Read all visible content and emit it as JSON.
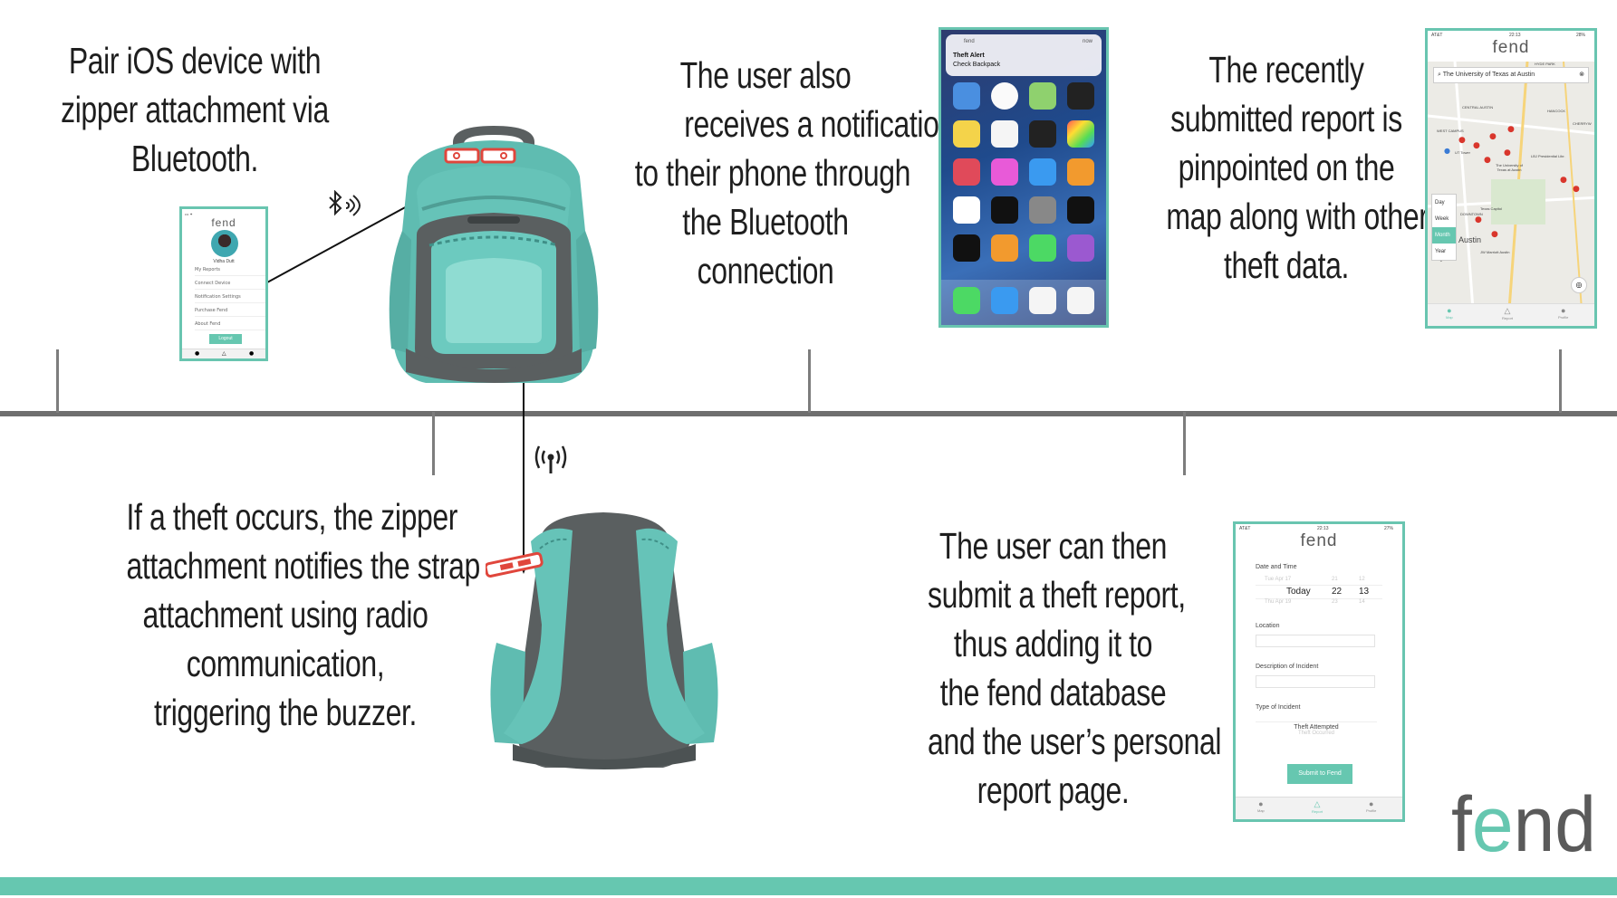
{
  "captions": {
    "pair": [
      "Pair iOS device with",
      "zipper attachment via",
      "Bluetooth."
    ],
    "notification": [
      "The user also",
      "receives a notification",
      "to their phone through",
      "the Bluetooth",
      "connection"
    ],
    "map": [
      "The recently",
      "submitted report is",
      "pinpointed on the",
      "map along with other",
      "theft data."
    ],
    "theft": [
      "If a theft occurs, the zipper",
      "attachment notifies the strap",
      "attachment using radio",
      "communication,",
      "triggering the buzzer."
    ],
    "report": [
      "The user can then",
      "submit a theft report,",
      "thus adding it to",
      "the fend database",
      "and the user’s personal",
      "report page."
    ]
  },
  "brand": {
    "logo_text": "fend",
    "accent": "#66c7b0",
    "timeline_color": "#6f6f6f"
  },
  "profile_phone": {
    "logo": "fend",
    "user_name": "Vidha Dutt",
    "menu": [
      "My Reports",
      "Connect Device",
      "Notification Settings",
      "Purchase Fend",
      "About Fend"
    ],
    "logout": "Logout"
  },
  "notification_phone": {
    "app": "fend",
    "time": "now",
    "title": "Theft Alert",
    "body": "Check Backpack",
    "dock": [
      "Phone",
      "Mail",
      "Safari",
      "Music"
    ]
  },
  "map_phone": {
    "carrier": "AT&T",
    "time": "22:13",
    "battery": "28%",
    "logo": "fend",
    "search_value": "The University of Texas at Austin",
    "filters": [
      "Day",
      "Week",
      "Month",
      "Year"
    ],
    "selected_filter": "Month",
    "places": [
      "HYDE PARK",
      "CENTRAL AUSTIN",
      "HANCOCK",
      "WEST CAMPUS",
      "UT Tower",
      "LBJ Presidential Libr.",
      "The University of Texas at Austin",
      "Texas Capitol",
      "DOWNTOWN",
      "Austin",
      "JW Marriott Austin",
      "CHERRYW",
      "Google"
    ],
    "tabs": [
      "Map",
      "Report",
      "Profile"
    ]
  },
  "report_phone": {
    "carrier": "AT&T",
    "time": "22:13",
    "battery": "27%",
    "logo": "fend",
    "date_label": "Date and Time",
    "picker_prev": [
      "Tue Apr 17",
      "21",
      "12"
    ],
    "picker_current": [
      "Today",
      "22",
      "13"
    ],
    "picker_next": [
      "Thu Apr 19",
      "23",
      "14"
    ],
    "location_label": "Location",
    "description_label": "Description of Incident",
    "type_label": "Type of Incident",
    "type_selected": "Theft Attempted",
    "type_other": "Theft Occurred",
    "submit": "Submit to Fend",
    "tabs": [
      "Map",
      "Report",
      "Profile"
    ]
  }
}
